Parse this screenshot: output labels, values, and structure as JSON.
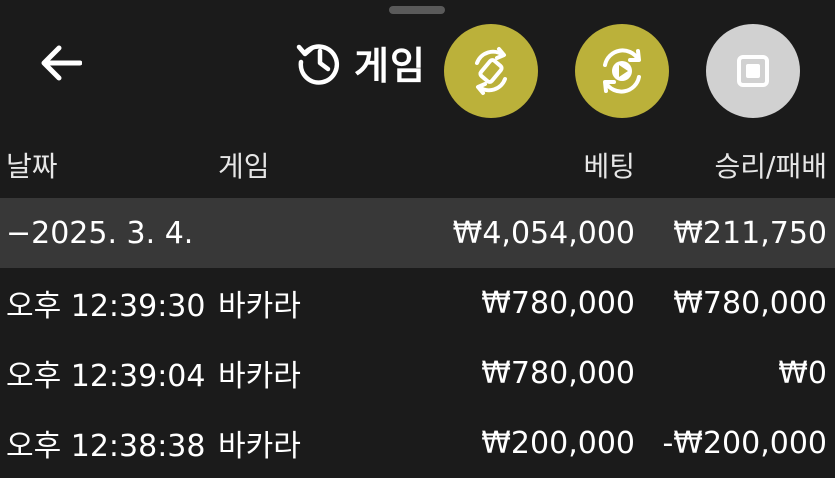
{
  "header": {
    "title": "게임",
    "back_icon": "arrow-left-icon",
    "history_icon": "history-clock-icon"
  },
  "fabs": [
    {
      "icon": "rotate-screen-icon",
      "color": "#bbb13a"
    },
    {
      "icon": "replay-play-icon",
      "color": "#bbb13a"
    },
    {
      "icon": "stop-square-icon",
      "color": "#d1d1d1"
    }
  ],
  "table": {
    "columns": {
      "date": "날짜",
      "game": "게임",
      "bet": "베팅",
      "result": "승리/패배"
    },
    "day_row": {
      "date": "−2025. 3. 4.",
      "bet": "₩4,054,000",
      "result": "₩211,750"
    },
    "rows": [
      {
        "time": "오후 12:39:30",
        "game": "바카라",
        "bet": "₩780,000",
        "result": "₩780,000"
      },
      {
        "time": "오후 12:39:04",
        "game": "바카라",
        "bet": "₩780,000",
        "result": "₩0"
      },
      {
        "time": "오후 12:38:38",
        "game": "바카라",
        "bet": "₩200,000",
        "result": "-₩200,000"
      }
    ]
  },
  "colors": {
    "background": "#1b1b1b",
    "accent": "#bbb13a",
    "day_row": "#383838"
  }
}
